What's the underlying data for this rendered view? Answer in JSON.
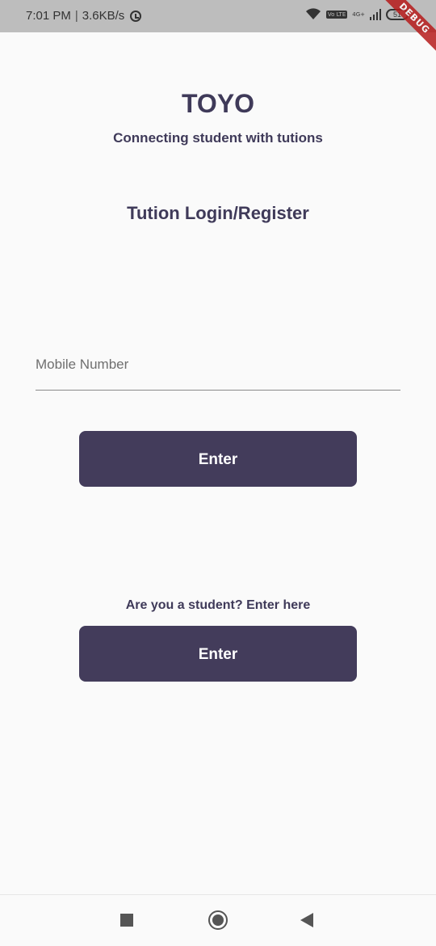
{
  "status_bar": {
    "time": "7:01 PM",
    "separator": "|",
    "network_speed": "3.6KB/s",
    "volte": "Vo LTE",
    "network_type": "4G+",
    "battery": "51",
    "icons": [
      "alarm-icon",
      "wifi-icon",
      "volte-icon",
      "signal-icon",
      "battery-icon"
    ]
  },
  "debug_banner": "DEBUG",
  "header": {
    "title": "TOYO",
    "subtitle": "Connecting student with tutions"
  },
  "tuition_section": {
    "heading": "Tution Login/Register",
    "mobile_placeholder": "Mobile Number",
    "mobile_value": "",
    "enter_label": "Enter"
  },
  "student_section": {
    "prompt": "Are you a student? Enter here",
    "enter_label": "Enter"
  },
  "nav_bar": {
    "icons": [
      "recents-icon",
      "home-icon",
      "back-icon"
    ]
  },
  "colors": {
    "primary": "#433c5b",
    "text": "#3f3a59",
    "background": "#fafafa",
    "status_bar": "#bdbdbd",
    "debug_ribbon": "#b71c1c"
  }
}
